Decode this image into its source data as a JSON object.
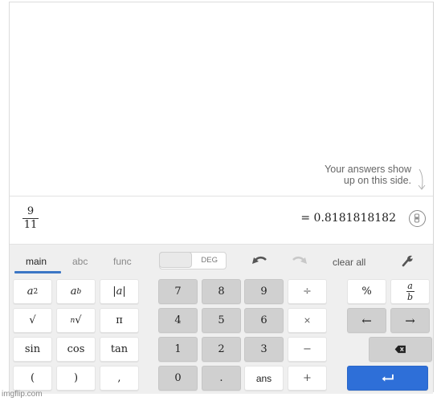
{
  "history": {
    "hint_line1": "Your answers show",
    "hint_line2": "up on this side."
  },
  "expression": {
    "numerator": "9",
    "denominator": "11",
    "result": "= 0.8181818182"
  },
  "tabs": [
    {
      "label": "main",
      "active": true
    },
    {
      "label": "abc",
      "active": false
    },
    {
      "label": "func",
      "active": false
    }
  ],
  "angle_toggle": {
    "label": "DEG",
    "selected": "RAD"
  },
  "toolbar": {
    "undo_icon": "undo-icon",
    "redo_icon": "redo-icon",
    "clear_all": "clear all",
    "settings_icon": "wrench-icon"
  },
  "keys": {
    "fn": {
      "square": "a",
      "square_exp": "2",
      "power": "a",
      "power_exp": "b",
      "abs": "|a|",
      "sqrt": "√",
      "nthroot_index": "n",
      "nthroot": "√",
      "pi": "π",
      "sin": "sin",
      "cos": "cos",
      "tan": "tan",
      "lparen": "(",
      "rparen": ")",
      "comma": ","
    },
    "digits": [
      "7",
      "8",
      "9",
      "4",
      "5",
      "6",
      "1",
      "2",
      "3",
      "0",
      "."
    ],
    "ans": "ans",
    "ops": {
      "divide": "÷",
      "multiply": "×",
      "minus": "−",
      "plus": "+"
    },
    "percent": "%",
    "fraction_num": "a",
    "fraction_den": "b",
    "left_arrow": "←",
    "right_arrow": "→",
    "backspace_icon": "backspace-icon",
    "enter_icon": "enter-icon"
  },
  "colors": {
    "accent": "#2e6fd8",
    "tab_underline": "#3b76c5"
  },
  "watermark": "imgflip.com"
}
